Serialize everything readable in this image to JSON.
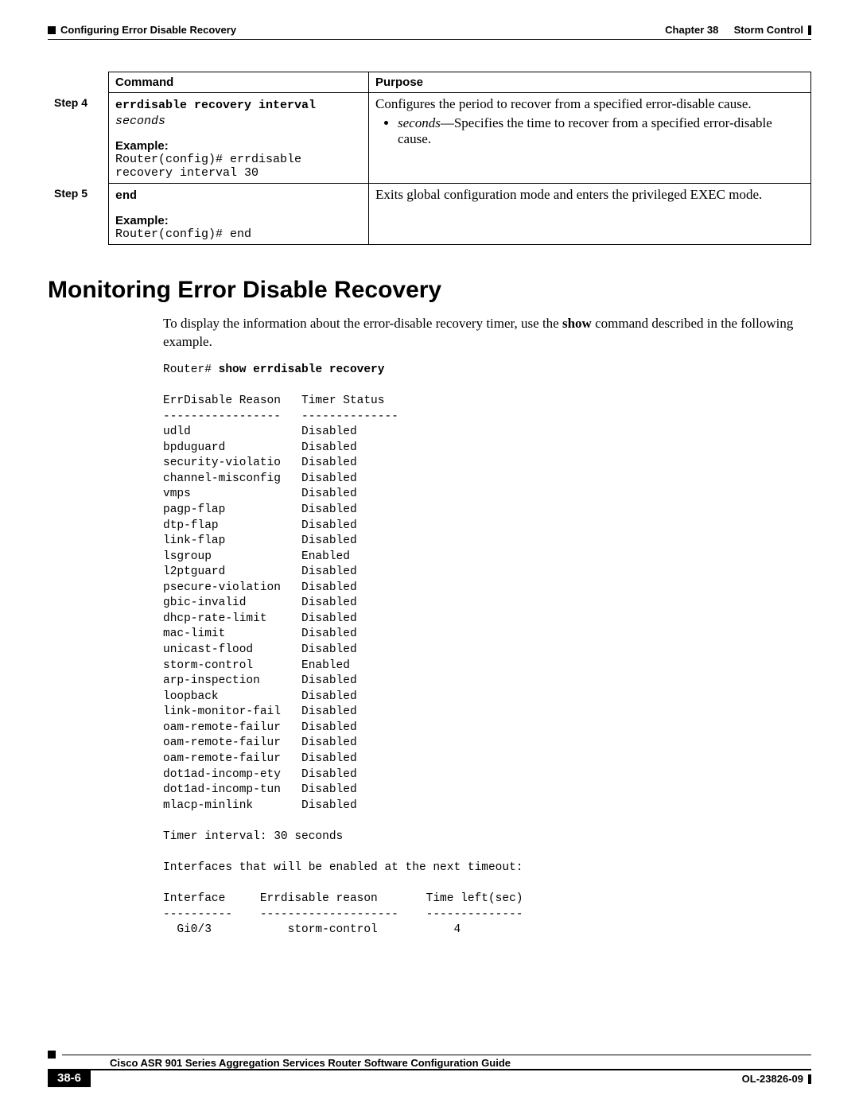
{
  "header": {
    "section_breadcrumb": "Configuring Error Disable Recovery",
    "chapter_label": "Chapter 38",
    "chapter_title": "Storm Control"
  },
  "table": {
    "col_command": "Command",
    "col_purpose": "Purpose",
    "step4": {
      "label": "Step 4",
      "cmd_bold": "errdisable recovery interval",
      "cmd_arg": "seconds",
      "example_label": "Example:",
      "example_text": "Router(config)# errdisable recovery interval 30",
      "purpose_line": "Configures the period to recover from a specified error-disable cause.",
      "bullet_arg": "seconds",
      "bullet_rest": "—Specifies the time to recover from a specified error-disable cause."
    },
    "step5": {
      "label": "Step 5",
      "cmd_bold": "end",
      "example_label": "Example:",
      "example_text": "Router(config)# end",
      "purpose_line": "Exits global configuration mode and enters the privileged EXEC mode."
    }
  },
  "section_heading": "Monitoring Error Disable Recovery",
  "intro_pre": "To display the information about the error-disable recovery timer, use the ",
  "intro_bold": "show",
  "intro_post": " command described in the following example.",
  "cli_prompt": "Router# ",
  "cli_cmd": "show errdisable recovery",
  "chart_data": {
    "type": "table",
    "title": "ErrDisable Reason / Timer Status",
    "columns": [
      "ErrDisable Reason",
      "Timer Status"
    ],
    "rows": [
      [
        "udld",
        "Disabled"
      ],
      [
        "bpduguard",
        "Disabled"
      ],
      [
        "security-violatio",
        "Disabled"
      ],
      [
        "channel-misconfig",
        "Disabled"
      ],
      [
        "vmps",
        "Disabled"
      ],
      [
        "pagp-flap",
        "Disabled"
      ],
      [
        "dtp-flap",
        "Disabled"
      ],
      [
        "link-flap",
        "Disabled"
      ],
      [
        "lsgroup",
        "Enabled"
      ],
      [
        "l2ptguard",
        "Disabled"
      ],
      [
        "psecure-violation",
        "Disabled"
      ],
      [
        "gbic-invalid",
        "Disabled"
      ],
      [
        "dhcp-rate-limit",
        "Disabled"
      ],
      [
        "mac-limit",
        "Disabled"
      ],
      [
        "unicast-flood",
        "Disabled"
      ],
      [
        "storm-control",
        "Enabled"
      ],
      [
        "arp-inspection",
        "Disabled"
      ],
      [
        "loopback",
        "Disabled"
      ],
      [
        "link-monitor-fail",
        "Disabled"
      ],
      [
        "oam-remote-failur",
        "Disabled"
      ],
      [
        "oam-remote-failur",
        "Disabled"
      ],
      [
        "oam-remote-failur",
        "Disabled"
      ],
      [
        "dot1ad-incomp-ety",
        "Disabled"
      ],
      [
        "dot1ad-incomp-tun",
        "Disabled"
      ],
      [
        "mlacp-minlink",
        "Disabled"
      ]
    ],
    "timer_interval_line": "Timer interval: 30 seconds",
    "next_timeout_line": "Interfaces that will be enabled at the next timeout:",
    "iface_columns": [
      "Interface",
      "Errdisable reason",
      "Time left(sec)"
    ],
    "iface_rows": [
      [
        "Gi0/3",
        "storm-control",
        "4"
      ]
    ]
  },
  "footer": {
    "book_title": "Cisco ASR 901 Series Aggregation Services Router Software Configuration Guide",
    "page_number": "38-6",
    "doc_id": "OL-23826-09"
  }
}
